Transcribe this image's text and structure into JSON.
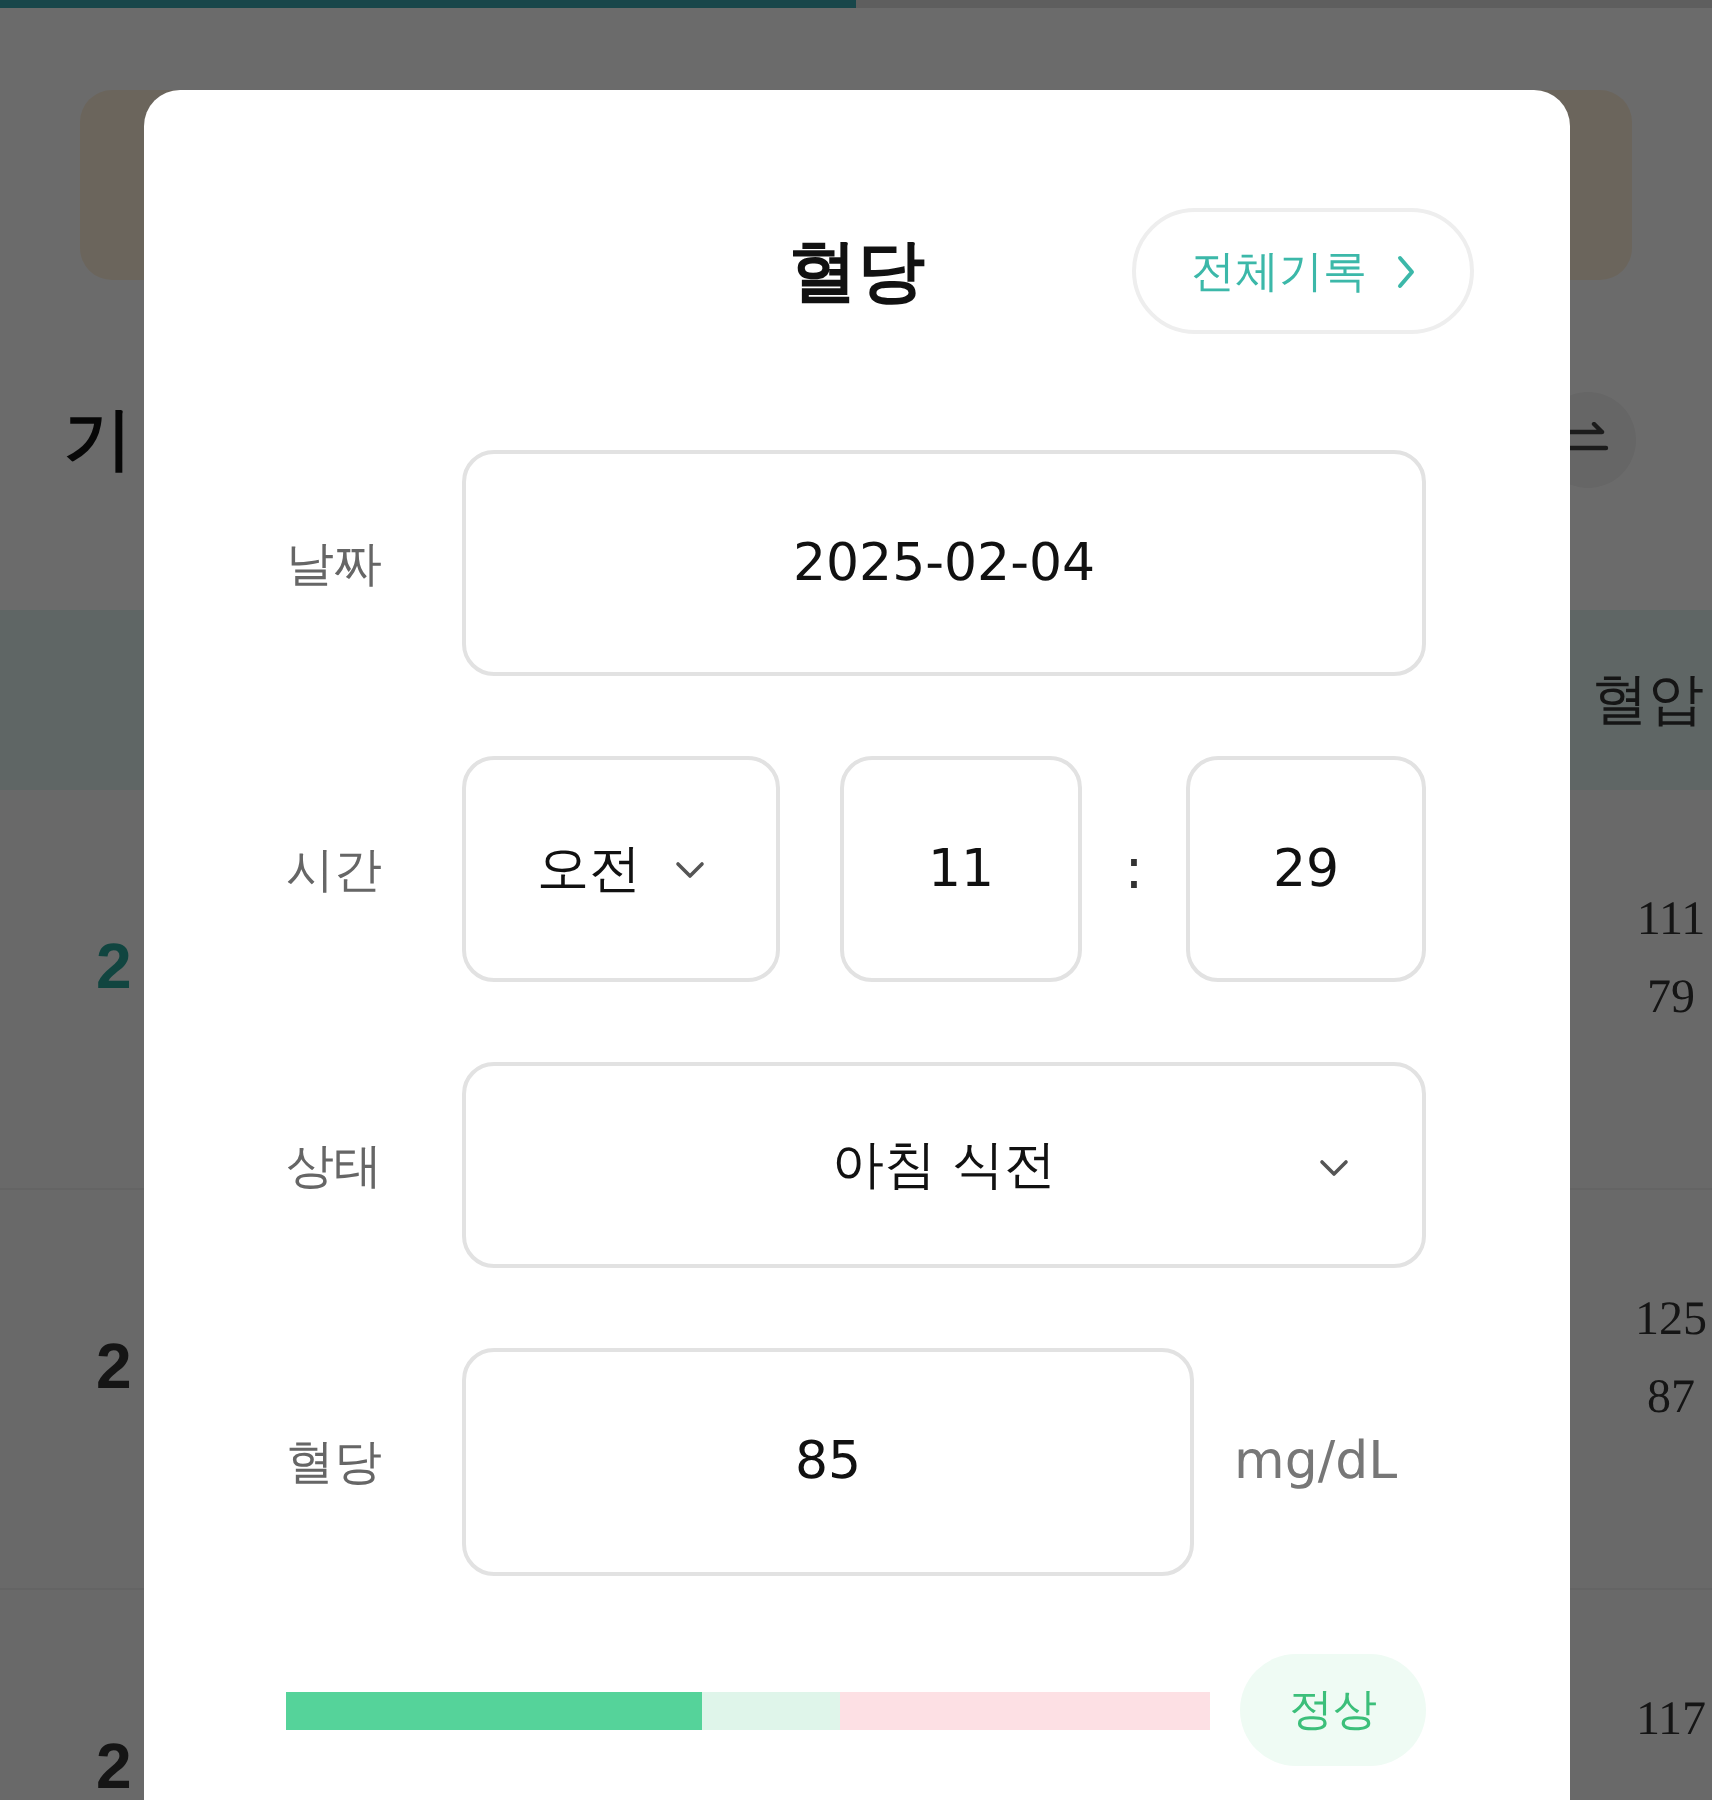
{
  "background": {
    "progress": {
      "level": 0.5
    },
    "title": "기",
    "table_header": "혈압",
    "rows": [
      {
        "date": "2",
        "selected": true,
        "values": [
          "111",
          "79"
        ]
      },
      {
        "date": "2",
        "selected": false,
        "values": [
          "125",
          "87"
        ]
      },
      {
        "date": "2",
        "selected": false,
        "values": [
          "117"
        ]
      }
    ]
  },
  "modal": {
    "title": "혈당",
    "all_records_button": "전체기록",
    "date": {
      "label": "날짜",
      "value": "2025-02-04"
    },
    "time": {
      "label": "시간",
      "period": "오전",
      "hour": "11",
      "separator": ":",
      "minute": "29"
    },
    "status": {
      "label": "상태",
      "value": "아침 식전"
    },
    "glucose": {
      "label": "혈당",
      "value": "85",
      "unit": "mg/dL"
    },
    "range": {
      "level": 0.45,
      "badge": "정상"
    }
  }
}
